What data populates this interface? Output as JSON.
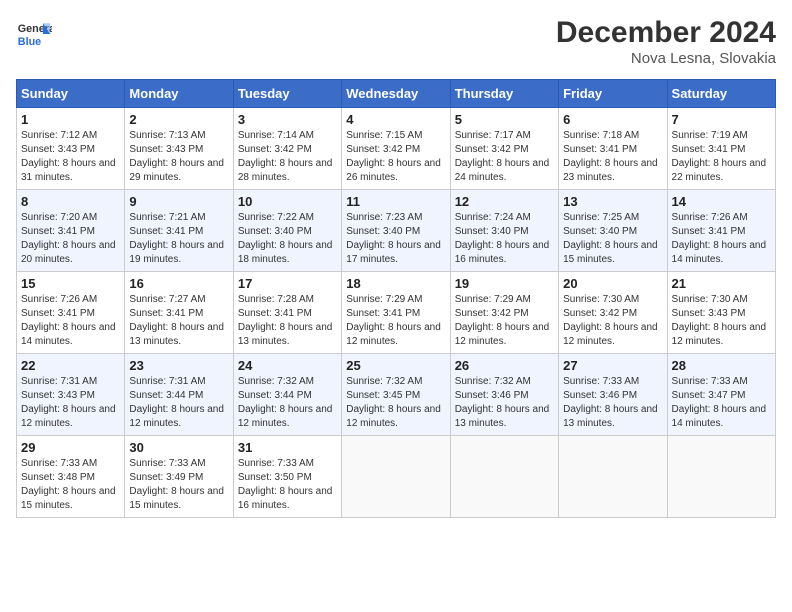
{
  "header": {
    "logo_line1": "General",
    "logo_line2": "Blue",
    "month": "December 2024",
    "location": "Nova Lesna, Slovakia"
  },
  "weekdays": [
    "Sunday",
    "Monday",
    "Tuesday",
    "Wednesday",
    "Thursday",
    "Friday",
    "Saturday"
  ],
  "weeks": [
    [
      {
        "day": "1",
        "sunrise": "7:12 AM",
        "sunset": "3:43 PM",
        "daylight": "8 hours and 31 minutes."
      },
      {
        "day": "2",
        "sunrise": "7:13 AM",
        "sunset": "3:43 PM",
        "daylight": "8 hours and 29 minutes."
      },
      {
        "day": "3",
        "sunrise": "7:14 AM",
        "sunset": "3:42 PM",
        "daylight": "8 hours and 28 minutes."
      },
      {
        "day": "4",
        "sunrise": "7:15 AM",
        "sunset": "3:42 PM",
        "daylight": "8 hours and 26 minutes."
      },
      {
        "day": "5",
        "sunrise": "7:17 AM",
        "sunset": "3:42 PM",
        "daylight": "8 hours and 24 minutes."
      },
      {
        "day": "6",
        "sunrise": "7:18 AM",
        "sunset": "3:41 PM",
        "daylight": "8 hours and 23 minutes."
      },
      {
        "day": "7",
        "sunrise": "7:19 AM",
        "sunset": "3:41 PM",
        "daylight": "8 hours and 22 minutes."
      }
    ],
    [
      {
        "day": "8",
        "sunrise": "7:20 AM",
        "sunset": "3:41 PM",
        "daylight": "8 hours and 20 minutes."
      },
      {
        "day": "9",
        "sunrise": "7:21 AM",
        "sunset": "3:41 PM",
        "daylight": "8 hours and 19 minutes."
      },
      {
        "day": "10",
        "sunrise": "7:22 AM",
        "sunset": "3:40 PM",
        "daylight": "8 hours and 18 minutes."
      },
      {
        "day": "11",
        "sunrise": "7:23 AM",
        "sunset": "3:40 PM",
        "daylight": "8 hours and 17 minutes."
      },
      {
        "day": "12",
        "sunrise": "7:24 AM",
        "sunset": "3:40 PM",
        "daylight": "8 hours and 16 minutes."
      },
      {
        "day": "13",
        "sunrise": "7:25 AM",
        "sunset": "3:40 PM",
        "daylight": "8 hours and 15 minutes."
      },
      {
        "day": "14",
        "sunrise": "7:26 AM",
        "sunset": "3:41 PM",
        "daylight": "8 hours and 14 minutes."
      }
    ],
    [
      {
        "day": "15",
        "sunrise": "7:26 AM",
        "sunset": "3:41 PM",
        "daylight": "8 hours and 14 minutes."
      },
      {
        "day": "16",
        "sunrise": "7:27 AM",
        "sunset": "3:41 PM",
        "daylight": "8 hours and 13 minutes."
      },
      {
        "day": "17",
        "sunrise": "7:28 AM",
        "sunset": "3:41 PM",
        "daylight": "8 hours and 13 minutes."
      },
      {
        "day": "18",
        "sunrise": "7:29 AM",
        "sunset": "3:41 PM",
        "daylight": "8 hours and 12 minutes."
      },
      {
        "day": "19",
        "sunrise": "7:29 AM",
        "sunset": "3:42 PM",
        "daylight": "8 hours and 12 minutes."
      },
      {
        "day": "20",
        "sunrise": "7:30 AM",
        "sunset": "3:42 PM",
        "daylight": "8 hours and 12 minutes."
      },
      {
        "day": "21",
        "sunrise": "7:30 AM",
        "sunset": "3:43 PM",
        "daylight": "8 hours and 12 minutes."
      }
    ],
    [
      {
        "day": "22",
        "sunrise": "7:31 AM",
        "sunset": "3:43 PM",
        "daylight": "8 hours and 12 minutes."
      },
      {
        "day": "23",
        "sunrise": "7:31 AM",
        "sunset": "3:44 PM",
        "daylight": "8 hours and 12 minutes."
      },
      {
        "day": "24",
        "sunrise": "7:32 AM",
        "sunset": "3:44 PM",
        "daylight": "8 hours and 12 minutes."
      },
      {
        "day": "25",
        "sunrise": "7:32 AM",
        "sunset": "3:45 PM",
        "daylight": "8 hours and 12 minutes."
      },
      {
        "day": "26",
        "sunrise": "7:32 AM",
        "sunset": "3:46 PM",
        "daylight": "8 hours and 13 minutes."
      },
      {
        "day": "27",
        "sunrise": "7:33 AM",
        "sunset": "3:46 PM",
        "daylight": "8 hours and 13 minutes."
      },
      {
        "day": "28",
        "sunrise": "7:33 AM",
        "sunset": "3:47 PM",
        "daylight": "8 hours and 14 minutes."
      }
    ],
    [
      {
        "day": "29",
        "sunrise": "7:33 AM",
        "sunset": "3:48 PM",
        "daylight": "8 hours and 15 minutes."
      },
      {
        "day": "30",
        "sunrise": "7:33 AM",
        "sunset": "3:49 PM",
        "daylight": "8 hours and 15 minutes."
      },
      {
        "day": "31",
        "sunrise": "7:33 AM",
        "sunset": "3:50 PM",
        "daylight": "8 hours and 16 minutes."
      },
      null,
      null,
      null,
      null
    ]
  ]
}
